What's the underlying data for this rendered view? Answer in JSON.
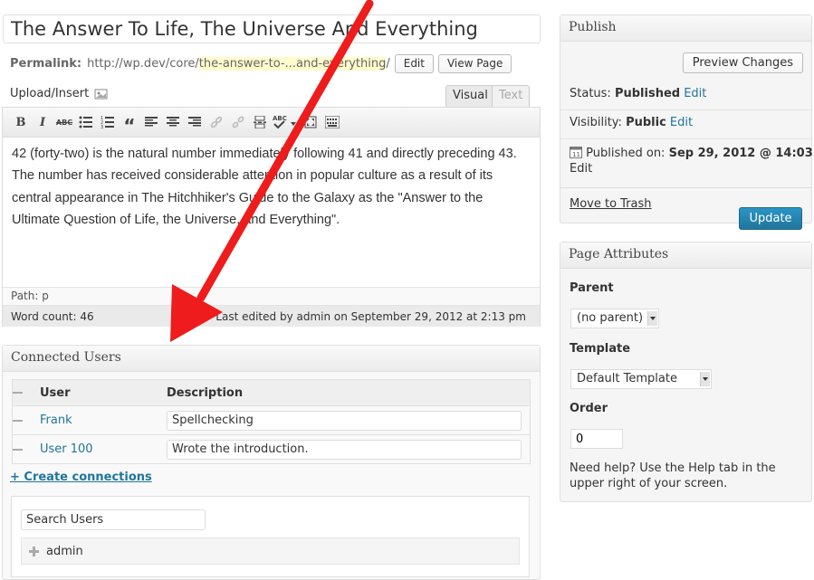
{
  "post": {
    "title": "The Answer To Life, The Universe And Everything",
    "permalink_label": "Permalink:",
    "permalink_base": "http://wp.dev/core/",
    "permalink_slug": "the-answer-to-...and-everything",
    "permalink_trailing": "/",
    "edit_label": "Edit",
    "view_page_label": "View Page"
  },
  "editor": {
    "upload_insert": "Upload/Insert",
    "tab_visual": "Visual",
    "tab_text": "Text",
    "content": "42 (forty-two) is the natural number immediately following 41 and directly preceding 43. The number has received considerable attention in popular culture as a result of its central appearance in The Hitchhiker's Guide to the Galaxy as the \"Answer to the Ultimate Question of Life, the Universe, and Everything\".",
    "path": "Path: p",
    "word_count": "Word count: 46",
    "last_edited": "Last edited by admin on September 29, 2012 at 2:13 pm",
    "toolbar_icons": [
      "bold-icon",
      "italic-icon",
      "strikethrough-icon",
      "bullet-list-icon",
      "numbered-list-icon",
      "blockquote-icon",
      "align-left-icon",
      "align-center-icon",
      "align-right-icon",
      "insert-link-icon",
      "unlink-icon",
      "more-tag-icon",
      "spellcheck-icon",
      "fullscreen-icon",
      "kitchen-sink-icon"
    ]
  },
  "connected_users": {
    "title": "Connected Users",
    "col_user": "User",
    "col_description": "Description",
    "rows": [
      {
        "user": "Frank",
        "description": "Spellchecking"
      },
      {
        "user": "User 100",
        "description": "Wrote the introduction."
      }
    ],
    "create_connections": "+ Create connections",
    "search_placeholder": "Search Users",
    "search_result": "admin"
  },
  "publish": {
    "title": "Publish",
    "preview_label": "Preview Changes",
    "status_label": "Status:",
    "status_value": "Published",
    "visibility_label": "Visibility:",
    "visibility_value": "Public",
    "edit_label": "Edit",
    "published_on_label": "Published on:",
    "published_on_value": "Sep 29, 2012 @ 14:03",
    "trash_label": "Move to Trash",
    "update_label": "Update"
  },
  "page_attributes": {
    "title": "Page Attributes",
    "parent_label": "Parent",
    "parent_value": "(no parent)",
    "template_label": "Template",
    "template_value": "Default Template",
    "order_label": "Order",
    "order_value": "0",
    "help_text": "Need help? Use the Help tab in the upper right of your screen."
  },
  "colors": {
    "link": "#21759b",
    "update_button": "#21759b",
    "trash": "#bc0b0b",
    "annotation_arrow": "#ee1c1c",
    "permalink_highlight": "#fffbcc"
  }
}
